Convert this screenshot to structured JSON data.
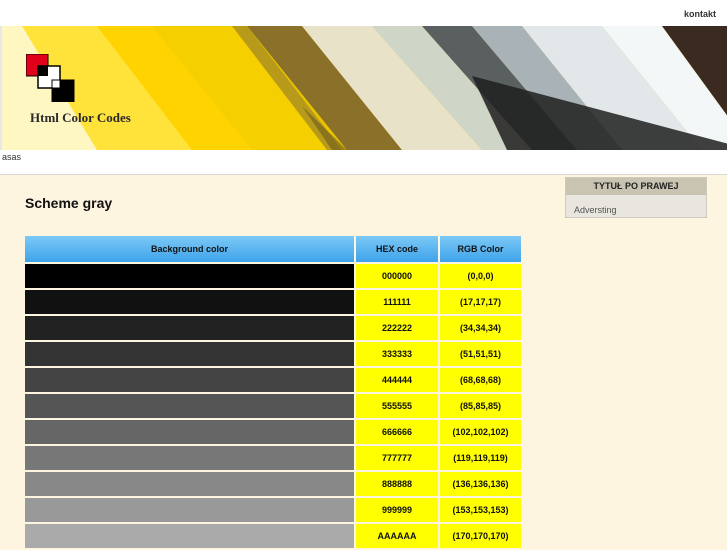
{
  "topbar": {
    "kontakt_label": "kontakt"
  },
  "header": {
    "logo_title": "Html Color Codes"
  },
  "subbar": {
    "text": "asas"
  },
  "main": {
    "title": "Scheme gray",
    "table": {
      "headers": [
        "Background color",
        "HEX code",
        "RGB Color"
      ],
      "rows": [
        {
          "hex": "000000",
          "rgb": "(0,0,0)",
          "color": "#000000"
        },
        {
          "hex": "111111",
          "rgb": "(17,17,17)",
          "color": "#111111"
        },
        {
          "hex": "222222",
          "rgb": "(34,34,34)",
          "color": "#222222"
        },
        {
          "hex": "333333",
          "rgb": "(51,51,51)",
          "color": "#333333"
        },
        {
          "hex": "444444",
          "rgb": "(68,68,68)",
          "color": "#444444"
        },
        {
          "hex": "555555",
          "rgb": "(85,85,85)",
          "color": "#555555"
        },
        {
          "hex": "666666",
          "rgb": "(102,102,102)",
          "color": "#666666"
        },
        {
          "hex": "777777",
          "rgb": "(119,119,119)",
          "color": "#777777"
        },
        {
          "hex": "888888",
          "rgb": "(136,136,136)",
          "color": "#888888"
        },
        {
          "hex": "999999",
          "rgb": "(153,153,153)",
          "color": "#999999"
        },
        {
          "hex": "AAAAAA",
          "rgb": "(170,170,170)",
          "color": "#aaaaaa"
        }
      ]
    }
  },
  "sidebar": {
    "title": "TYTUŁ PO PRAWEJ",
    "link": "Adversting"
  },
  "colors": {
    "page_bg": "#fdf5e0",
    "header_cell": "#5bb6f0",
    "value_cell": "#ffff00"
  }
}
